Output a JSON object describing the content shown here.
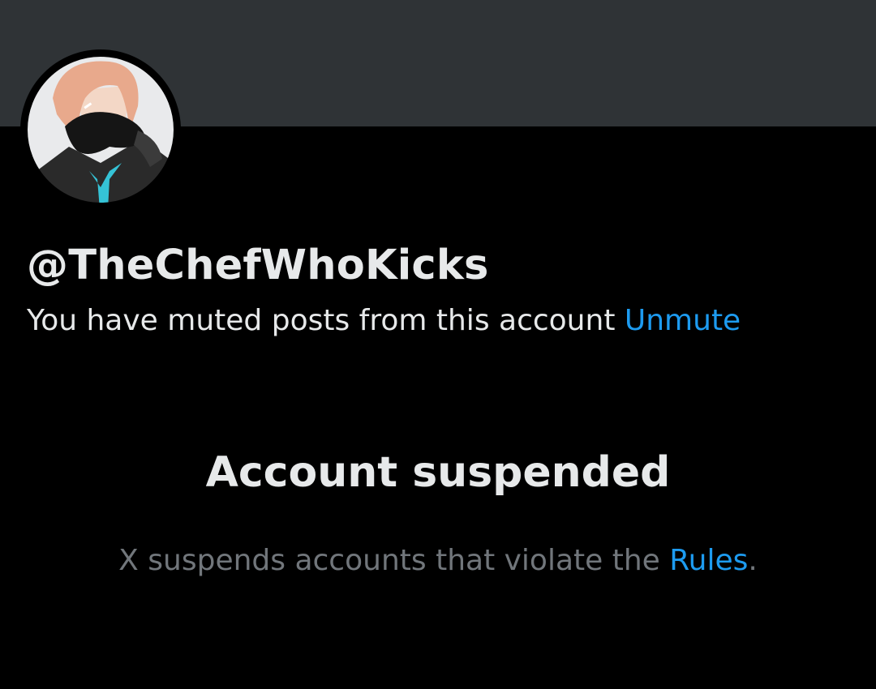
{
  "profile": {
    "handle": "@TheChefWhoKicks",
    "avatar_icon": "profile-avatar",
    "banner_color": "#2f3336"
  },
  "mute_notice": {
    "text": "You have muted posts from this account",
    "unmute_label": "Unmute"
  },
  "suspension": {
    "title": "Account suspended",
    "description_prefix": "X suspends accounts that violate the",
    "rules_label": "Rules",
    "description_suffix": "."
  },
  "colors": {
    "background": "#000000",
    "primary_text": "#e7e9ea",
    "secondary_text": "#71767b",
    "link": "#1d9bf0"
  }
}
